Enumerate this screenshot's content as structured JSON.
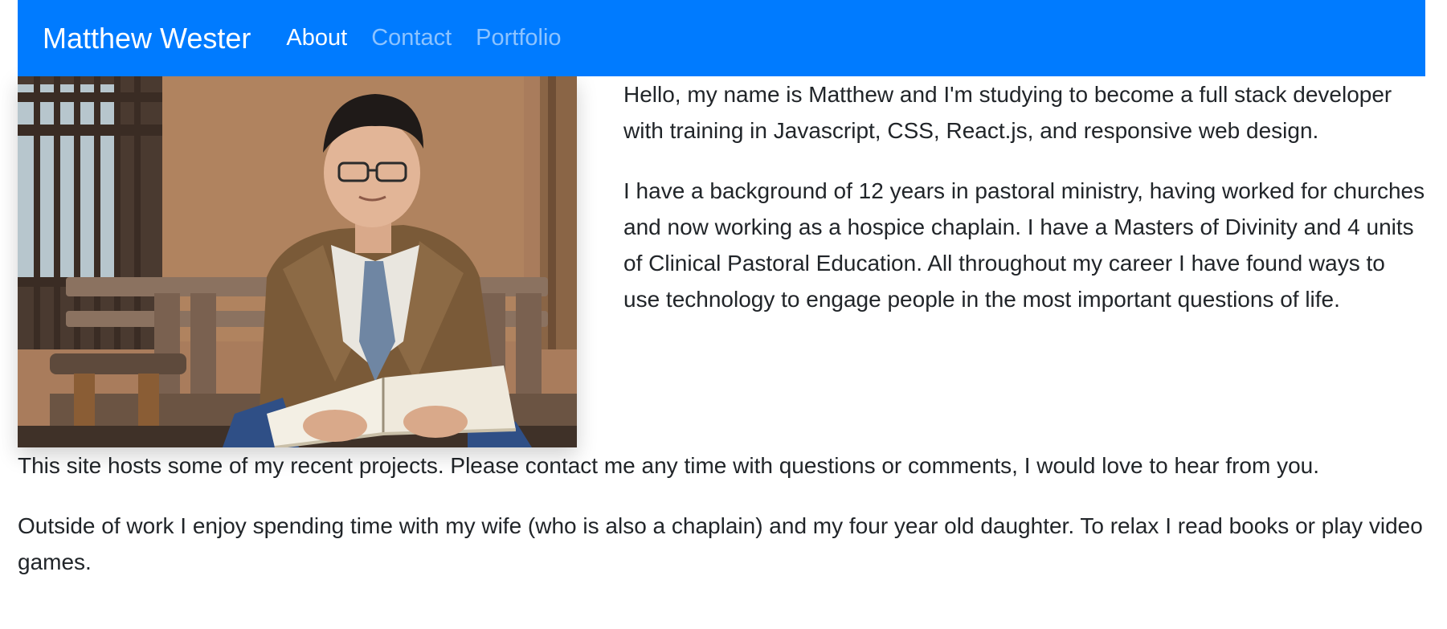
{
  "navbar": {
    "brand": "Matthew Wester",
    "links": [
      {
        "label": "About",
        "active": true
      },
      {
        "label": "Contact",
        "active": false
      },
      {
        "label": "Portfolio",
        "active": false
      }
    ],
    "color": "#007bff"
  },
  "profile_photo": {
    "alt": "Matthew Wester"
  },
  "about": {
    "intro": "Hello, my name is Matthew and I'm studying to become a full stack developer with training in Javascript, CSS, React.js, and responsive web design.",
    "background": "I have a background of 12 years in pastoral ministry, having worked for churches and now working as a hospice chaplain. I have a Masters of Divinity and 4 units of Clinical Pastoral Education. All throughout my career I have found ways to use technology to engage people in the most important questions of life.",
    "site_note": "This site hosts some of my recent projects. Please contact me any time with questions or comments, I would love to hear from you.",
    "personal": "Outside of work I enjoy spending time with my wife (who is also a chaplain) and my four year old daughter. To relax I read books or play video games."
  }
}
